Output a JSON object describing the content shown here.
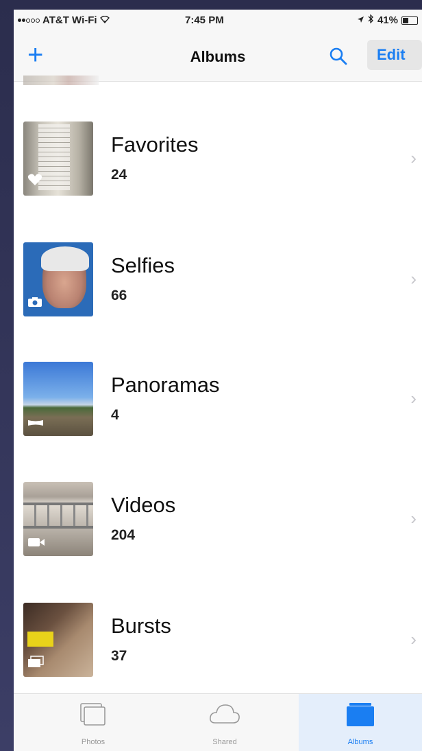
{
  "status_bar": {
    "carrier": "AT&T Wi-Fi",
    "time": "7:45 PM",
    "battery": "41%"
  },
  "nav": {
    "add_icon": "plus-icon",
    "title": "Albums",
    "search_icon": "search-icon",
    "edit_label": "Edit"
  },
  "albums": [
    {
      "name": "Favorites",
      "count": "24",
      "badge_icon": "heart-icon"
    },
    {
      "name": "Selfies",
      "count": "66",
      "badge_icon": "camera-icon"
    },
    {
      "name": "Panoramas",
      "count": "4",
      "badge_icon": "panorama-icon"
    },
    {
      "name": "Videos",
      "count": "204",
      "badge_icon": "video-camera-icon"
    },
    {
      "name": "Bursts",
      "count": "37",
      "badge_icon": "burst-icon"
    }
  ],
  "tabs": [
    {
      "label": "Photos",
      "icon": "photos-icon",
      "active": false
    },
    {
      "label": "Shared",
      "icon": "cloud-icon",
      "active": false
    },
    {
      "label": "Albums",
      "icon": "albums-icon",
      "active": true
    }
  ],
  "colors": {
    "accent": "#1a7ef2",
    "chevron": "#c7c7cc",
    "bar_background": "#f7f7f7"
  }
}
